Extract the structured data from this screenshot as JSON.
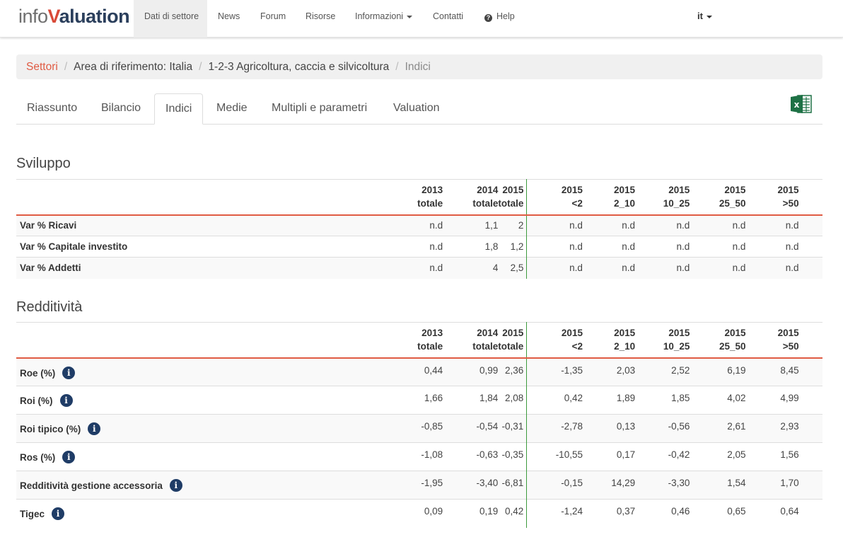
{
  "brand": {
    "logo_part1": "info",
    "logo_v": "V",
    "logo_part2": "aluation"
  },
  "nav": {
    "items": [
      "Dati di settore",
      "News",
      "Forum",
      "Risorse",
      "Informazioni",
      "Contatti",
      "Help"
    ],
    "active": "Dati di settore",
    "language": "it"
  },
  "breadcrumb": {
    "root": "Settori",
    "level1": "Area di riferimento: Italia",
    "level2": "1-2-3 Agricoltura, caccia e silvicoltura",
    "current": "Indici"
  },
  "tabs": [
    "Riassunto",
    "Bilancio",
    "Indici",
    "Medie",
    "Multipli e parametri",
    "Valuation"
  ],
  "active_tab": "Indici",
  "columns": [
    {
      "year": "2013",
      "group": "totale"
    },
    {
      "year": "2014",
      "group": "totale"
    },
    {
      "year": "2015",
      "group": "totale"
    },
    {
      "year": "2015",
      "group": "<2"
    },
    {
      "year": "2015",
      "group": "2_10"
    },
    {
      "year": "2015",
      "group": "10_25"
    },
    {
      "year": "2015",
      "group": "25_50"
    },
    {
      "year": "2015",
      "group": ">50"
    }
  ],
  "sviluppo": {
    "title": "Sviluppo",
    "rows": [
      {
        "label": "Var % Ricavi",
        "values": [
          "n.d",
          "1,1",
          "2",
          "n.d",
          "n.d",
          "n.d",
          "n.d",
          "n.d"
        ]
      },
      {
        "label": "Var % Capitale investito",
        "values": [
          "n.d",
          "1,8",
          "1,2",
          "n.d",
          "n.d",
          "n.d",
          "n.d",
          "n.d"
        ]
      },
      {
        "label": "Var % Addetti",
        "values": [
          "n.d",
          "4",
          "2,5",
          "n.d",
          "n.d",
          "n.d",
          "n.d",
          "n.d"
        ]
      }
    ]
  },
  "redditivita": {
    "title": "Redditività",
    "rows": [
      {
        "label": "Roe (%)",
        "values": [
          "0,44",
          "0,99",
          "2,36",
          "-1,35",
          "2,03",
          "2,52",
          "6,19",
          "8,45"
        ]
      },
      {
        "label": "Roi (%)",
        "values": [
          "1,66",
          "1,84",
          "2,08",
          "0,42",
          "1,89",
          "1,85",
          "4,02",
          "4,99"
        ]
      },
      {
        "label": "Roi tipico (%)",
        "values": [
          "-0,85",
          "-0,54",
          "-0,31",
          "-2,78",
          "0,13",
          "-0,56",
          "2,61",
          "2,93"
        ]
      },
      {
        "label": "Ros (%)",
        "values": [
          "-1,08",
          "-0,63",
          "-0,35",
          "-10,55",
          "0,17",
          "-0,42",
          "2,05",
          "1,56"
        ]
      },
      {
        "label": "Redditività gestione accessoria",
        "values": [
          "-1,95",
          "-3,40",
          "-6,81",
          "-0,15",
          "14,29",
          "-3,30",
          "1,54",
          "1,70"
        ]
      },
      {
        "label": "Tigec",
        "values": [
          "0,09",
          "0,19",
          "0,42",
          "-1,24",
          "0,37",
          "0,46",
          "0,65",
          "0,64"
        ]
      }
    ]
  },
  "icons": {
    "info": "info-circle-icon",
    "excel": "excel-export-icon",
    "help": "question-circle-icon"
  },
  "colors": {
    "accent": "#e05b43",
    "divider": "#3c9a3c",
    "info_icon": "#1f3c66",
    "excel": "#1e7145"
  }
}
